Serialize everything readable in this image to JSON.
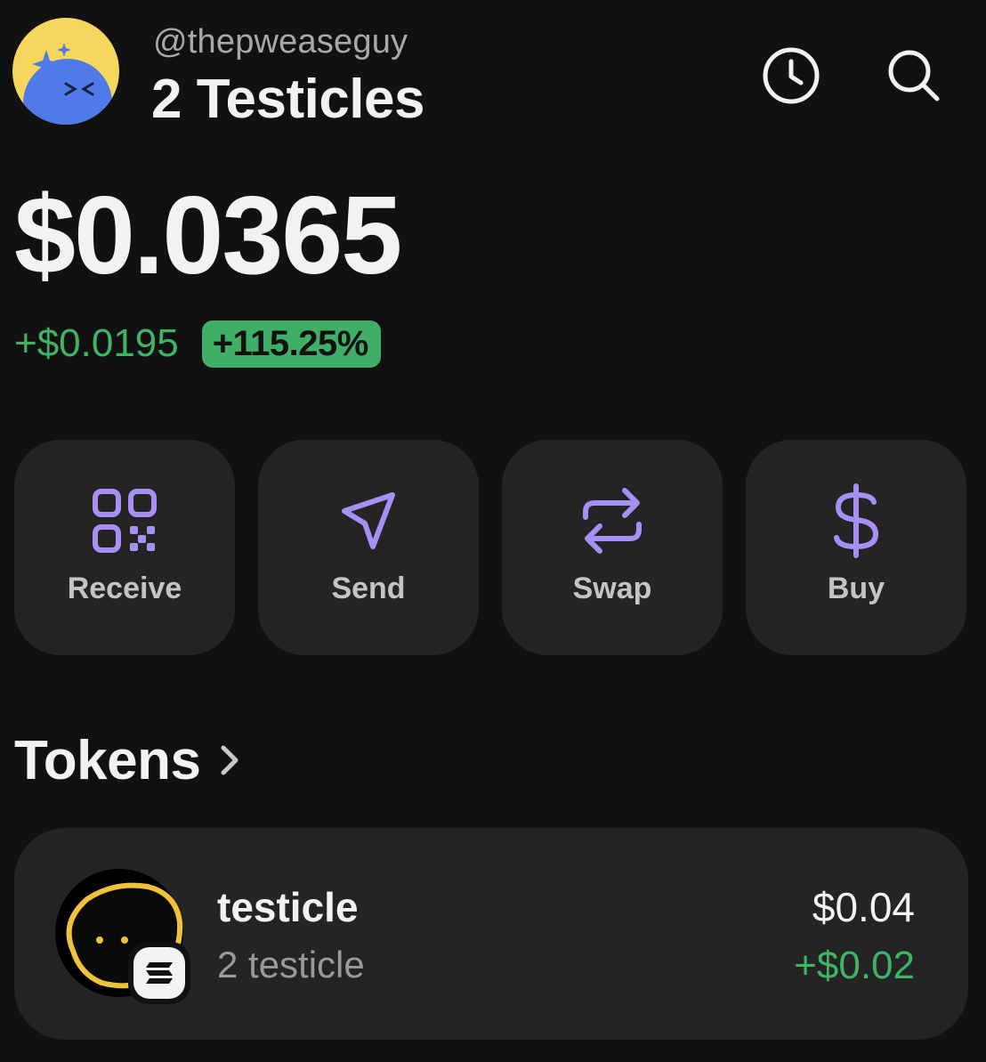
{
  "header": {
    "handle": "@thepweaseguy",
    "wallet_name": "2 Testicles",
    "history_icon": "clock-icon",
    "search_icon": "search-icon"
  },
  "balance": {
    "total": "$0.0365",
    "change_amount": "+$0.0195",
    "change_percent": "+115.25%"
  },
  "actions": [
    {
      "label": "Receive",
      "icon": "qr-code-icon"
    },
    {
      "label": "Send",
      "icon": "paper-plane-icon"
    },
    {
      "label": "Swap",
      "icon": "swap-arrows-icon"
    },
    {
      "label": "Buy",
      "icon": "dollar-sign-icon"
    }
  ],
  "tokens": {
    "title": "Tokens",
    "items": [
      {
        "name": "testicle",
        "quantity": "2 testicle",
        "value": "$0.04",
        "change": "+$0.02"
      }
    ]
  },
  "colors": {
    "background": "#111111",
    "card": "#242424",
    "accent_purple": "#a88ff5",
    "positive_green": "#3fb465",
    "badge_green": "#3fae66"
  }
}
